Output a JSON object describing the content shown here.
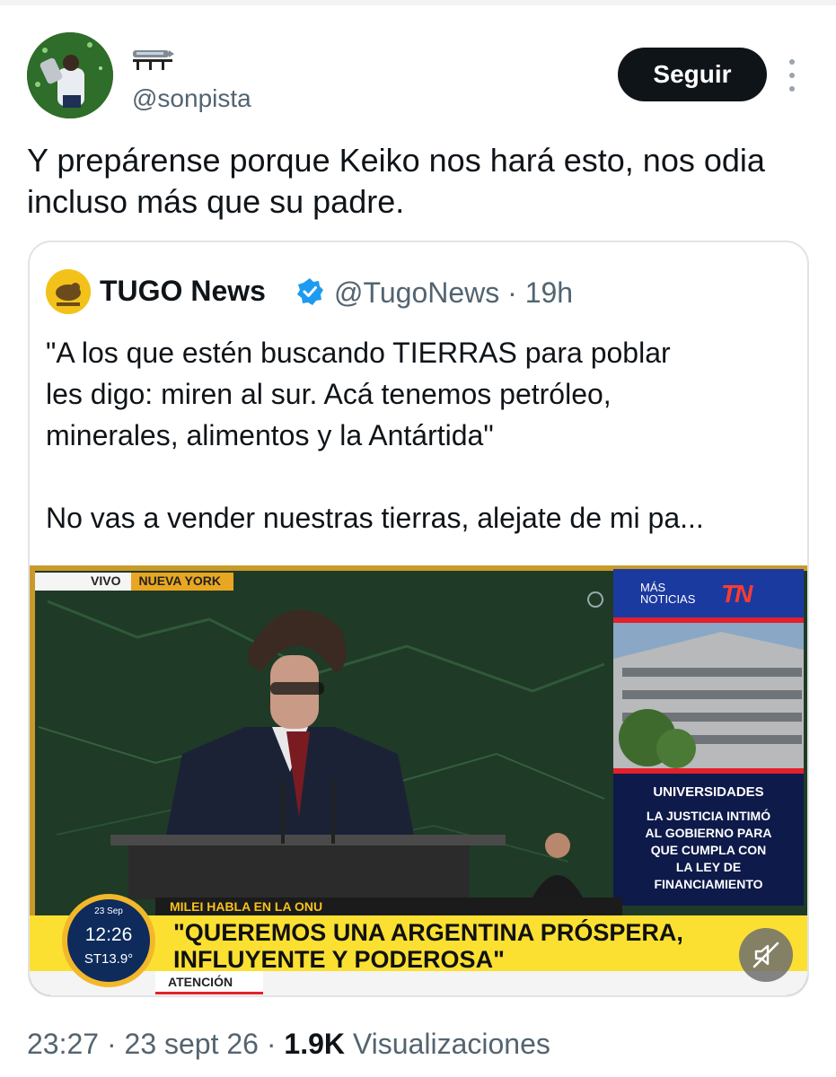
{
  "author": {
    "display_name": "🚄",
    "handle": "@sonpista",
    "follow_label": "Seguir"
  },
  "tweet": {
    "text": "Y prepárense porque Keiko nos hará esto, nos odia incluso más que su padre."
  },
  "quoted": {
    "name": "TUGO News",
    "handle": "@TugoNews",
    "separator": "·",
    "time": "19h",
    "text_1": "\"A los que estén buscando TIERRAS para poblar\nles digo: miren al sur. Acá tenemos petróleo,\nminerales, alimentos y la Antártida\"",
    "text_2": "No vas a vender nuestras tierras, alejate de mi pa...",
    "video": {
      "live_label": "VIVO",
      "city_label": "NUEVA YORK",
      "side_header": "MÁS\nNOTICIAS",
      "side_logo": "TN",
      "side_title": "UNIVERSIDADES",
      "side_body": "LA JUSTICIA INTIMÓ\nAL GOBIERNO PARA\nQUE CUMPLA CON\nLA LEY DE\nFINANCIAMIENTO",
      "lower_third_kicker": "MILEI HABLA EN LA ONU",
      "headline": "\"QUEREMOS UNA ARGENTINA PRÓSPERA,\nINFLUYENTE Y PODEROSA\"",
      "attention_label": "ATENCIÓN",
      "clock_date": "23 Sep",
      "clock_time": "12:26",
      "clock_temp": "ST13.9°",
      "mute_icon": "volume-muted-icon"
    }
  },
  "meta": {
    "time": "23:27",
    "separator": "·",
    "date": "23 sept 26",
    "views_count": "1.9K",
    "views_label": "Visualizaciones"
  },
  "colors": {
    "text": "#0f1419",
    "secondary": "#536471",
    "verified": "#1d9bf0",
    "button_bg": "#0f1419",
    "tn_yellow": "#fbe032",
    "tn_blue": "#1b3aa0",
    "tn_red": "#e3202b"
  }
}
